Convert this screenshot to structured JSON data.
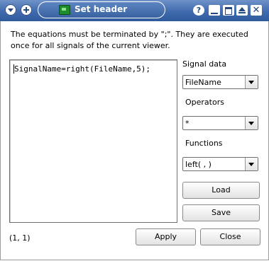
{
  "window": {
    "title": "Set header",
    "controls": {
      "help": "?",
      "close": "✕"
    }
  },
  "description": "The equations must be terminated by \";\". They are executed once for all signals of the current viewer.",
  "editor": {
    "content": "SignalName=right(FileName,5);"
  },
  "signal_data": {
    "label": "Signal data",
    "selected": "FileName"
  },
  "operators": {
    "label": "Operators",
    "selected": "*"
  },
  "functions": {
    "label": "Functions",
    "selected": "left( , )"
  },
  "buttons": {
    "load": "Load",
    "save": "Save",
    "apply": "Apply",
    "close": "Close"
  },
  "status": {
    "cursor_position": "(1, 1)"
  },
  "colors": {
    "titlebar": "#3f6aad",
    "window_bg": "#ffffff"
  }
}
